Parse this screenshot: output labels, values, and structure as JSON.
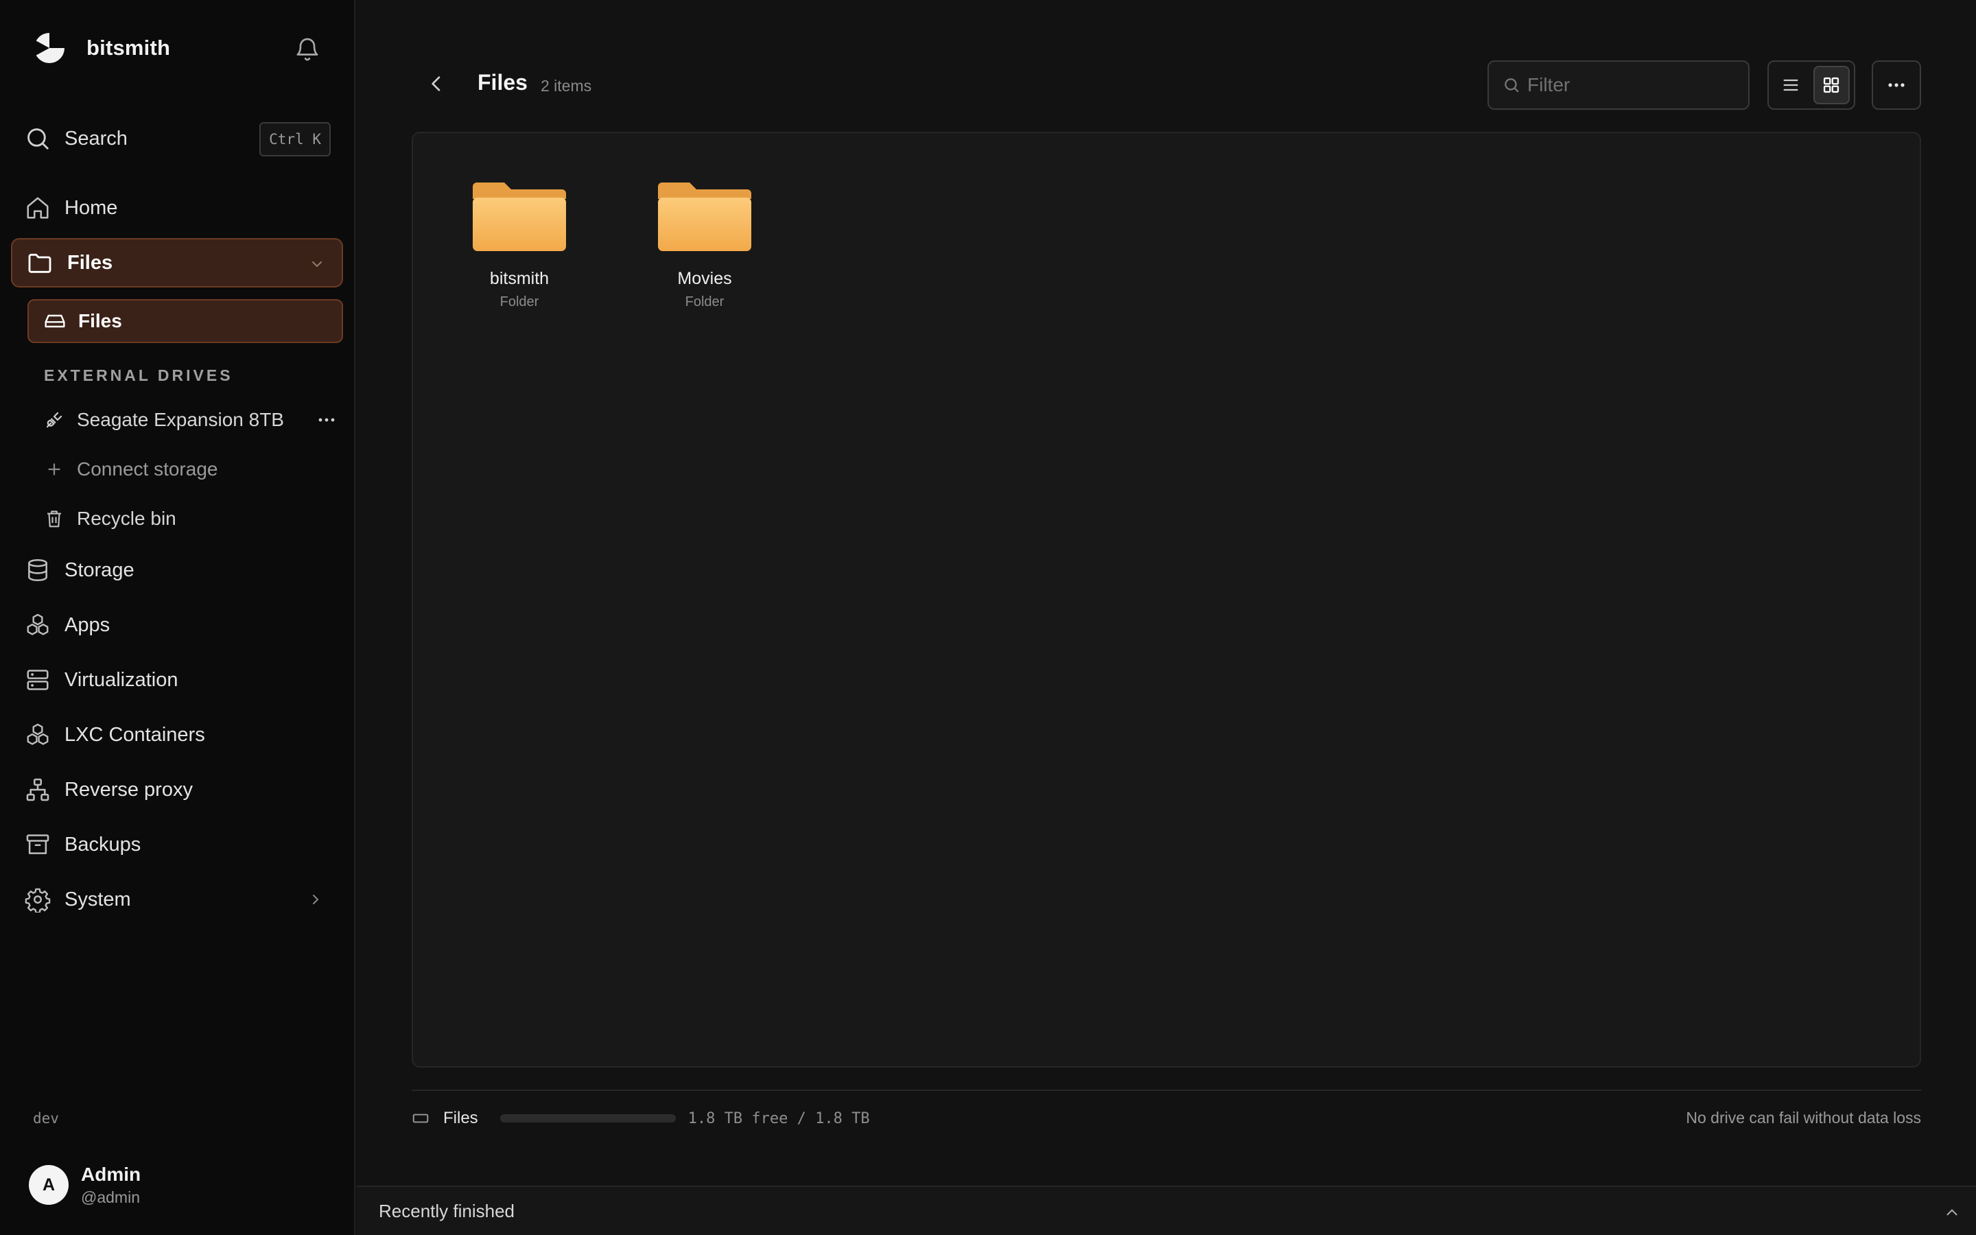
{
  "app": {
    "name": "bitsmith",
    "env": "dev"
  },
  "search": {
    "label": "Search",
    "shortcut": "Ctrl K"
  },
  "nav": {
    "home": "Home",
    "files": "Files",
    "files_sub": "Files",
    "section_external": "EXTERNAL DRIVES",
    "seagate": "Seagate Expansion 8TB",
    "connect": "Connect storage",
    "recycle": "Recycle bin",
    "storage": "Storage",
    "apps": "Apps",
    "virtualization": "Virtualization",
    "lxc": "LXC Containers",
    "proxy": "Reverse proxy",
    "backups": "Backups",
    "system": "System"
  },
  "user": {
    "initial": "A",
    "name": "Admin",
    "handle": "@admin"
  },
  "header": {
    "title": "Files",
    "count": "2 items"
  },
  "filter": {
    "placeholder": "Filter"
  },
  "folders": [
    {
      "name": "bitsmith",
      "kind": "Folder"
    },
    {
      "name": "Movies",
      "kind": "Folder"
    }
  ],
  "footer": {
    "drive_label": "Files",
    "usage_fraction": 0.0,
    "free_text": "1.8 TB free / 1.8 TB",
    "redundancy": "No drive can fail without data loss"
  },
  "recent": {
    "label": "Recently finished"
  },
  "colors": {
    "accent_bg": "#3a2218",
    "accent_border": "#6d3a24",
    "folder": "#f6b75c"
  }
}
